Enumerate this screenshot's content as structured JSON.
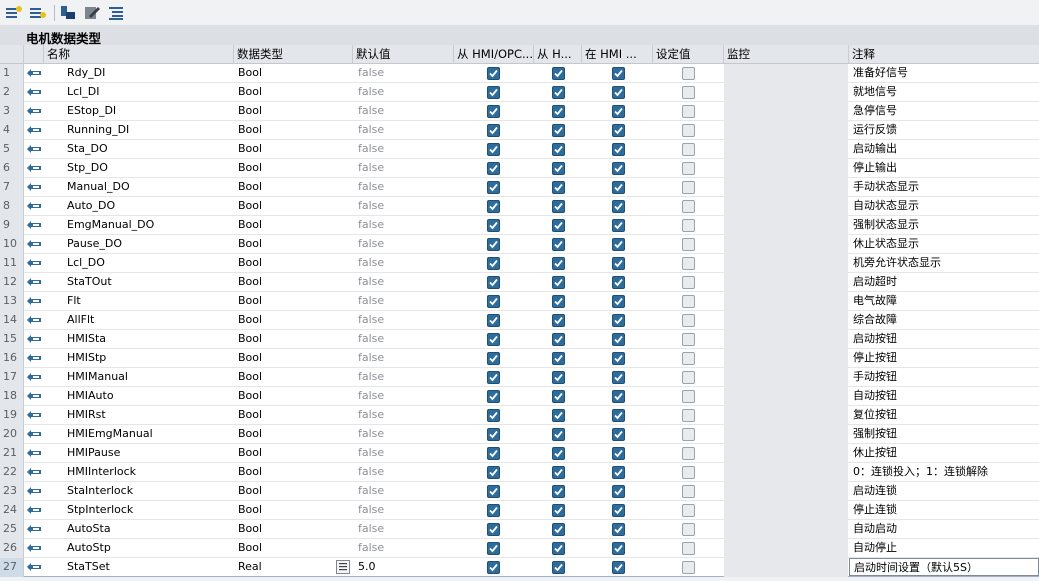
{
  "toolbar": {
    "icons": [
      "insert-row-icon",
      "add-row-icon",
      "add-member-icon",
      "edit-icon",
      "tree-view-icon"
    ]
  },
  "title": "电机数据类型",
  "headers": {
    "name": "名称",
    "datatype": "数据类型",
    "default": "默认值",
    "hmi_opc": "从 HMI/OPC...",
    "hmi_h": "从 H...",
    "in_hmi": "在 HMI ...",
    "setpoint": "设定值",
    "monitor": "监控",
    "comment": "注释"
  },
  "colors": {
    "accent": "#2e6c9c",
    "header_bg": "#e3e6ea",
    "title_bg": "#dcdfe4"
  },
  "rows": [
    {
      "num": "1",
      "name": "Rdy_DI",
      "type": "Bool",
      "default": "false",
      "c1": true,
      "c2": true,
      "c3": true,
      "c4": false,
      "comment": "准备好信号"
    },
    {
      "num": "2",
      "name": "Lcl_DI",
      "type": "Bool",
      "default": "false",
      "c1": true,
      "c2": true,
      "c3": true,
      "c4": false,
      "comment": "就地信号"
    },
    {
      "num": "3",
      "name": "EStop_DI",
      "type": "Bool",
      "default": "false",
      "c1": true,
      "c2": true,
      "c3": true,
      "c4": false,
      "comment": "急停信号"
    },
    {
      "num": "4",
      "name": "Running_DI",
      "type": "Bool",
      "default": "false",
      "c1": true,
      "c2": true,
      "c3": true,
      "c4": false,
      "comment": "运行反馈"
    },
    {
      "num": "5",
      "name": "Sta_DO",
      "type": "Bool",
      "default": "false",
      "c1": true,
      "c2": true,
      "c3": true,
      "c4": false,
      "comment": "启动输出"
    },
    {
      "num": "6",
      "name": "Stp_DO",
      "type": "Bool",
      "default": "false",
      "c1": true,
      "c2": true,
      "c3": true,
      "c4": false,
      "comment": "停止输出"
    },
    {
      "num": "7",
      "name": "Manual_DO",
      "type": "Bool",
      "default": "false",
      "c1": true,
      "c2": true,
      "c3": true,
      "c4": false,
      "comment": "手动状态显示"
    },
    {
      "num": "8",
      "name": "Auto_DO",
      "type": "Bool",
      "default": "false",
      "c1": true,
      "c2": true,
      "c3": true,
      "c4": false,
      "comment": "自动状态显示"
    },
    {
      "num": "9",
      "name": "EmgManual_DO",
      "type": "Bool",
      "default": "false",
      "c1": true,
      "c2": true,
      "c3": true,
      "c4": false,
      "comment": "强制状态显示"
    },
    {
      "num": "10",
      "name": "Pause_DO",
      "type": "Bool",
      "default": "false",
      "c1": true,
      "c2": true,
      "c3": true,
      "c4": false,
      "comment": "休止状态显示"
    },
    {
      "num": "11",
      "name": "Lcl_DO",
      "type": "Bool",
      "default": "false",
      "c1": true,
      "c2": true,
      "c3": true,
      "c4": false,
      "comment": "机旁允许状态显示"
    },
    {
      "num": "12",
      "name": "StaTOut",
      "type": "Bool",
      "default": "false",
      "c1": true,
      "c2": true,
      "c3": true,
      "c4": false,
      "comment": "启动超时"
    },
    {
      "num": "13",
      "name": "Flt",
      "type": "Bool",
      "default": "false",
      "c1": true,
      "c2": true,
      "c3": true,
      "c4": false,
      "comment": "电气故障"
    },
    {
      "num": "14",
      "name": "AllFlt",
      "type": "Bool",
      "default": "false",
      "c1": true,
      "c2": true,
      "c3": true,
      "c4": false,
      "comment": "综合故障"
    },
    {
      "num": "15",
      "name": "HMISta",
      "type": "Bool",
      "default": "false",
      "c1": true,
      "c2": true,
      "c3": true,
      "c4": false,
      "comment": "启动按钮"
    },
    {
      "num": "16",
      "name": "HMIStp",
      "type": "Bool",
      "default": "false",
      "c1": true,
      "c2": true,
      "c3": true,
      "c4": false,
      "comment": "停止按钮"
    },
    {
      "num": "17",
      "name": "HMIManual",
      "type": "Bool",
      "default": "false",
      "c1": true,
      "c2": true,
      "c3": true,
      "c4": false,
      "comment": "手动按钮"
    },
    {
      "num": "18",
      "name": "HMIAuto",
      "type": "Bool",
      "default": "false",
      "c1": true,
      "c2": true,
      "c3": true,
      "c4": false,
      "comment": "自动按钮"
    },
    {
      "num": "19",
      "name": "HMIRst",
      "type": "Bool",
      "default": "false",
      "c1": true,
      "c2": true,
      "c3": true,
      "c4": false,
      "comment": "复位按钮"
    },
    {
      "num": "20",
      "name": "HMIEmgManual",
      "type": "Bool",
      "default": "false",
      "c1": true,
      "c2": true,
      "c3": true,
      "c4": false,
      "comment": "强制按钮"
    },
    {
      "num": "21",
      "name": "HMIPause",
      "type": "Bool",
      "default": "false",
      "c1": true,
      "c2": true,
      "c3": true,
      "c4": false,
      "comment": "休止按钮"
    },
    {
      "num": "22",
      "name": "HMIInterlock",
      "type": "Bool",
      "default": "false",
      "c1": true,
      "c2": true,
      "c3": true,
      "c4": false,
      "comment": "0：连锁投入；1：连锁解除"
    },
    {
      "num": "23",
      "name": "StaInterlock",
      "type": "Bool",
      "default": "false",
      "c1": true,
      "c2": true,
      "c3": true,
      "c4": false,
      "comment": "启动连锁"
    },
    {
      "num": "24",
      "name": "StpInterlock",
      "type": "Bool",
      "default": "false",
      "c1": true,
      "c2": true,
      "c3": true,
      "c4": false,
      "comment": "停止连锁"
    },
    {
      "num": "25",
      "name": "AutoSta",
      "type": "Bool",
      "default": "false",
      "c1": true,
      "c2": true,
      "c3": true,
      "c4": false,
      "comment": "自动启动"
    },
    {
      "num": "26",
      "name": "AutoStp",
      "type": "Bool",
      "default": "false",
      "c1": true,
      "c2": true,
      "c3": true,
      "c4": false,
      "comment": "自动停止"
    },
    {
      "num": "27",
      "name": "StaTSet",
      "type": "Real",
      "default": "5.0",
      "c1": true,
      "c2": true,
      "c3": true,
      "c4": false,
      "comment": "启动时间设置（默认5S）"
    }
  ]
}
